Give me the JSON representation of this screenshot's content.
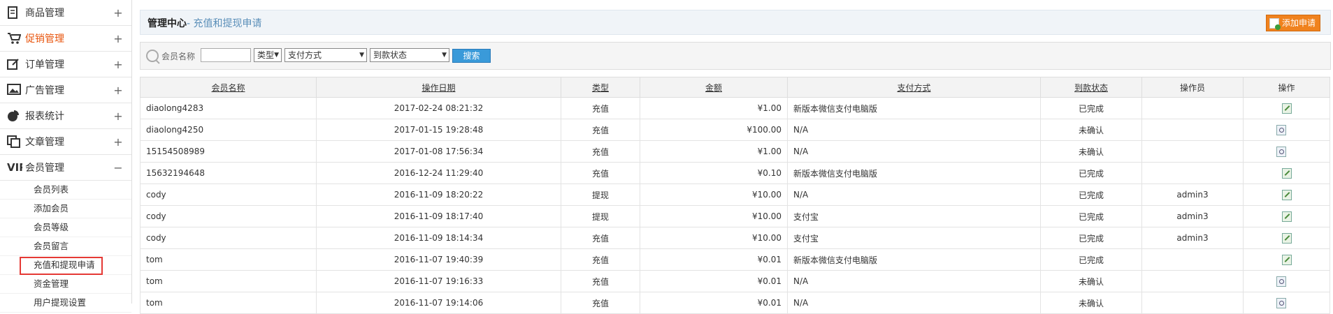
{
  "sidebar": {
    "items": [
      {
        "label": "商品管理",
        "icon": "document-icon",
        "toggle": "+"
      },
      {
        "label": "促销管理",
        "icon": "cart-icon",
        "toggle": "+",
        "active": true
      },
      {
        "label": "订单管理",
        "icon": "edit-icon",
        "toggle": "+"
      },
      {
        "label": "广告管理",
        "icon": "image-icon",
        "toggle": "+"
      },
      {
        "label": "报表统计",
        "icon": "pie-chart-icon",
        "toggle": "+"
      },
      {
        "label": "文章管理",
        "icon": "copy-icon",
        "toggle": "+"
      },
      {
        "label": "会员管理",
        "icon": "vip-icon",
        "toggle": "−"
      }
    ],
    "submenu": [
      "会员列表",
      "添加会员",
      "会员等级",
      "会员留言",
      "充值和提现申请",
      "资金管理",
      "用户提现设置"
    ],
    "current_sub": 4
  },
  "header": {
    "title": "管理中心",
    "subtitle": "- 充值和提现申请",
    "add_button": "添加申请"
  },
  "filter": {
    "member_label": "会员名称",
    "member_value": "",
    "type_select": "类型",
    "payment_select": "支付方式",
    "status_select": "到款状态",
    "search_button": "搜索"
  },
  "table": {
    "columns": [
      "会员名称",
      "操作日期",
      "类型",
      "金额",
      "支付方式",
      "到款状态",
      "操作员",
      "操作"
    ],
    "rows": [
      {
        "member": "diaolong4283",
        "date": "2017-02-24 08:21:32",
        "type": "充值",
        "amount": "¥1.00",
        "payment": "新版本微信支付电脑版",
        "status": "已完成",
        "operator": "",
        "actions": [
          "edit"
        ]
      },
      {
        "member": "diaolong4250",
        "date": "2017-01-15 19:28:48",
        "type": "充值",
        "amount": "¥100.00",
        "payment": "N/A",
        "status": "未确认",
        "operator": "",
        "actions": [
          "view",
          "delete"
        ]
      },
      {
        "member": "15154508989",
        "date": "2017-01-08 17:56:34",
        "type": "充值",
        "amount": "¥1.00",
        "payment": "N/A",
        "status": "未确认",
        "operator": "",
        "actions": [
          "view",
          "delete"
        ]
      },
      {
        "member": "15632194648",
        "date": "2016-12-24 11:29:40",
        "type": "充值",
        "amount": "¥0.10",
        "payment": "新版本微信支付电脑版",
        "status": "已完成",
        "operator": "",
        "actions": [
          "edit"
        ]
      },
      {
        "member": "cody",
        "date": "2016-11-09 18:20:22",
        "type": "提现",
        "amount": "¥10.00",
        "payment": "N/A",
        "status": "已完成",
        "operator": "admin3",
        "actions": [
          "edit"
        ]
      },
      {
        "member": "cody",
        "date": "2016-11-09 18:17:40",
        "type": "提现",
        "amount": "¥10.00",
        "payment": "支付宝",
        "status": "已完成",
        "operator": "admin3",
        "actions": [
          "edit"
        ]
      },
      {
        "member": "cody",
        "date": "2016-11-09 18:14:34",
        "type": "充值",
        "amount": "¥10.00",
        "payment": "支付宝",
        "status": "已完成",
        "operator": "admin3",
        "actions": [
          "edit"
        ]
      },
      {
        "member": "tom",
        "date": "2016-11-07 19:40:39",
        "type": "充值",
        "amount": "¥0.01",
        "payment": "新版本微信支付电脑版",
        "status": "已完成",
        "operator": "",
        "actions": [
          "edit"
        ]
      },
      {
        "member": "tom",
        "date": "2016-11-07 19:16:33",
        "type": "充值",
        "amount": "¥0.01",
        "payment": "N/A",
        "status": "未确认",
        "operator": "",
        "actions": [
          "view",
          "delete"
        ]
      },
      {
        "member": "tom",
        "date": "2016-11-07 19:14:06",
        "type": "充值",
        "amount": "¥0.01",
        "payment": "N/A",
        "status": "未确认",
        "operator": "",
        "actions": [
          "view",
          "delete"
        ]
      }
    ]
  },
  "colors": {
    "accent": "#e8540c",
    "button_blue": "#3a9ad9",
    "add_orange": "#f0821e",
    "highlight_box": "#e53935"
  }
}
